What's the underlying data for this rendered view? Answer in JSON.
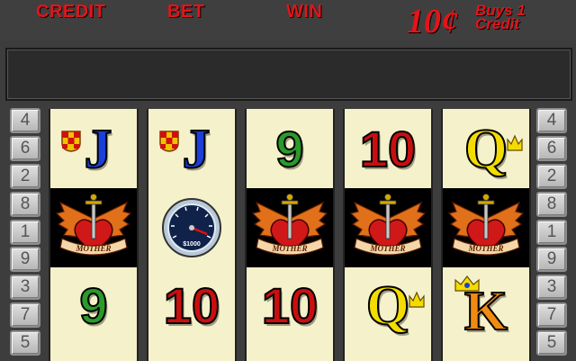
{
  "header": {
    "credit_label": "CREDIT",
    "bet_label": "BET",
    "win_label": "WIN",
    "denomination": "10¢",
    "buys_line1": "Buys 1",
    "buys_line2": "Credit"
  },
  "message": "",
  "lines_left": [
    "4",
    "6",
    "2",
    "8",
    "1",
    "9",
    "3",
    "7",
    "5"
  ],
  "lines_right": [
    "4",
    "6",
    "2",
    "8",
    "1",
    "9",
    "3",
    "7",
    "5"
  ],
  "reels": [
    [
      "J",
      "MOTHER",
      "9"
    ],
    [
      "J",
      "SPEEDOMETER",
      "10"
    ],
    [
      "9",
      "MOTHER",
      "10"
    ],
    [
      "10",
      "MOTHER",
      "Q"
    ],
    [
      "Q",
      "MOTHER",
      "K"
    ]
  ],
  "symbol_texts": {
    "mother_banner": "MOTHER",
    "speed_readout": "$1000"
  },
  "colors": {
    "background": "#3d3d3d",
    "label_red": "#e3141a",
    "reel_cream": "#f5f2cb",
    "j_blue": "#1c3fd8",
    "nine_green": "#2a9a2a",
    "ten_red": "#c80f10",
    "q_yellow": "#f3dc00",
    "k_orange": "#f08a10"
  }
}
